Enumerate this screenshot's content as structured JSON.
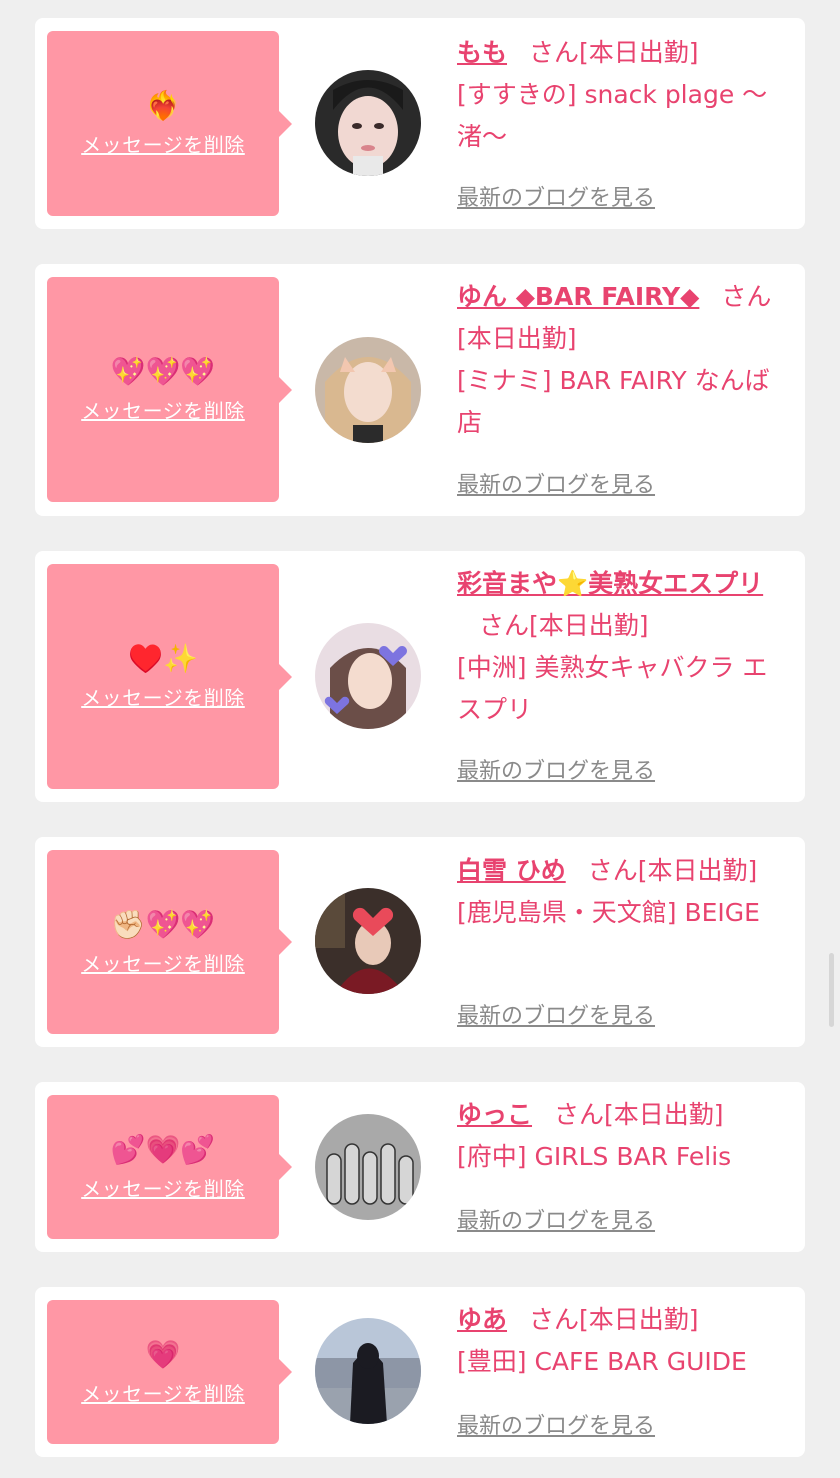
{
  "colors": {
    "accent": "#e8436f",
    "bubble": "#ff97a5",
    "background": "#efefef"
  },
  "delete_label": "メッセージを削除",
  "suffix_label": "さん[本日出勤]",
  "blog_label": "最新のブログを見る",
  "cards": [
    {
      "emoji": "❤️‍🔥",
      "name": "もも",
      "shop": "[すすきの] snack plage 〜渚〜",
      "avatar": "avatar-momo"
    },
    {
      "emoji": "💖💖💖",
      "name": "ゆん ◆BAR FAIRY◆",
      "shop": "[ミナミ] BAR FAIRY なんば店",
      "avatar": "avatar-yun"
    },
    {
      "emoji": "♥️✨",
      "name": "彩音まや⭐美熟女エスプリ",
      "shop": "[中洲] 美熟女キャバクラ エスプリ",
      "avatar": "avatar-maya"
    },
    {
      "emoji": "✊🏻💖💖",
      "name": "白雪 ひめ",
      "shop": "[鹿児島県・天文館] BEIGE",
      "avatar": "avatar-hime"
    },
    {
      "emoji": "💕💗💕",
      "name": "ゆっこ",
      "shop": "[府中] GIRLS BAR Felis",
      "avatar": "avatar-yukko"
    },
    {
      "emoji": "💗",
      "name": "ゆあ",
      "shop": "[豊田] CAFE BAR GUIDE",
      "avatar": "avatar-yua"
    }
  ]
}
